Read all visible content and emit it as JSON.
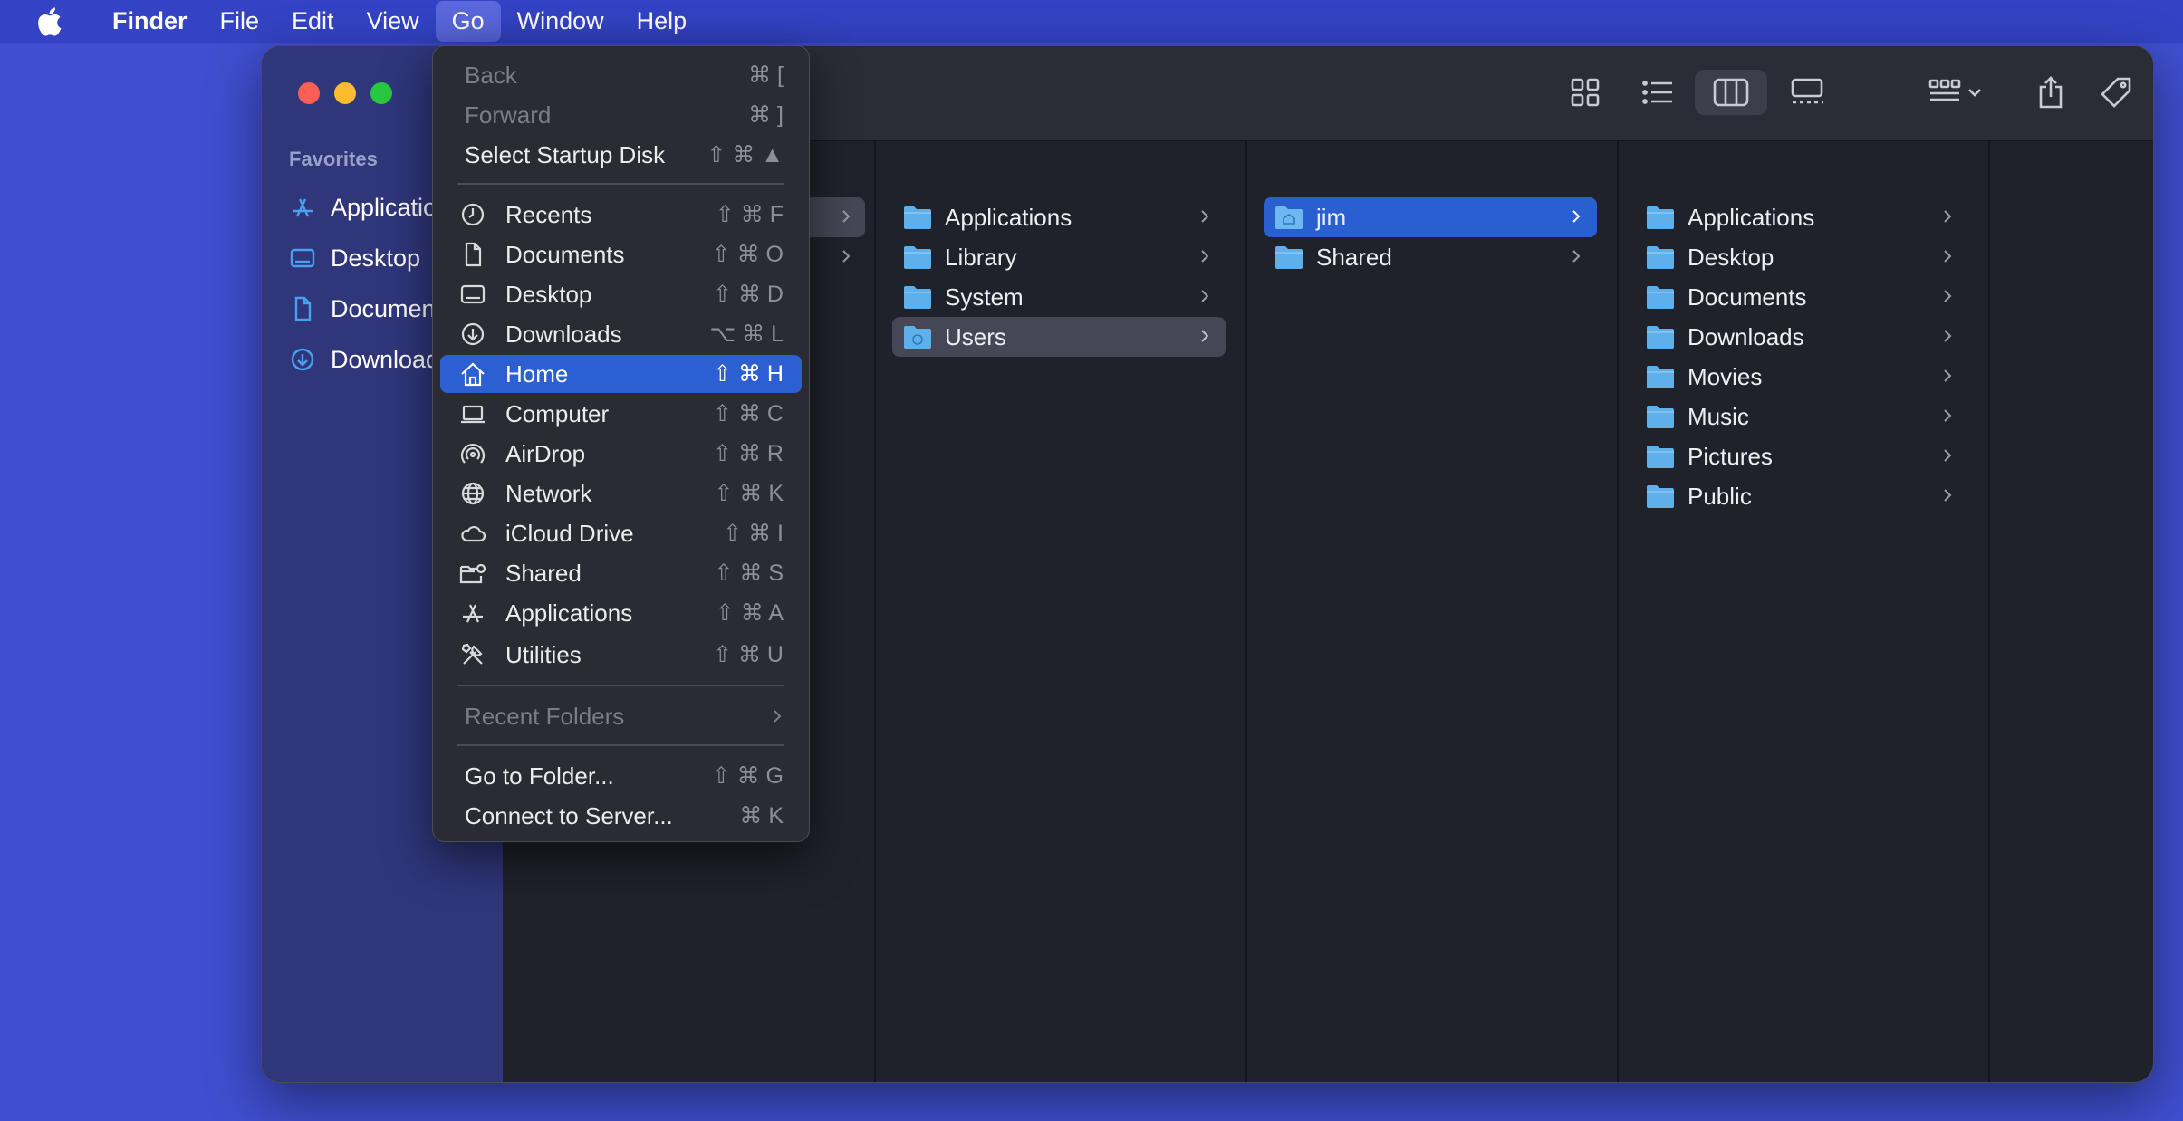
{
  "menubar": {
    "app_name": "Finder",
    "items": [
      "File",
      "Edit",
      "View",
      "Go",
      "Window",
      "Help"
    ],
    "active": "Go"
  },
  "sidebar": {
    "section": "Favorites",
    "items": [
      {
        "label": "Applications",
        "icon": "applications-icon"
      },
      {
        "label": "Desktop",
        "icon": "desktop-icon"
      },
      {
        "label": "Documents",
        "icon": "document-icon"
      },
      {
        "label": "Downloads",
        "icon": "download-icon"
      }
    ]
  },
  "columns": {
    "root": [
      "Applications",
      "Library",
      "System",
      "Users"
    ],
    "users": [
      "jim",
      "Shared"
    ],
    "jim": [
      "Applications",
      "Desktop",
      "Documents",
      "Downloads",
      "Movies",
      "Music",
      "Pictures",
      "Public"
    ],
    "selected_root": "Users",
    "selected_users": "jim"
  },
  "go_menu": {
    "back": {
      "label": "Back",
      "shortcut": "⌘ ["
    },
    "forward": {
      "label": "Forward",
      "shortcut": "⌘ ]"
    },
    "startup": {
      "label": "Select Startup Disk",
      "shortcut": "⇧ ⌘ ▲"
    },
    "items": [
      {
        "label": "Recents",
        "shortcut": "⇧ ⌘ F",
        "icon": "clock-icon"
      },
      {
        "label": "Documents",
        "shortcut": "⇧ ⌘ O",
        "icon": "document-icon"
      },
      {
        "label": "Desktop",
        "shortcut": "⇧ ⌘ D",
        "icon": "desktop-icon"
      },
      {
        "label": "Downloads",
        "shortcut": "⌥ ⌘ L",
        "icon": "download-icon"
      },
      {
        "label": "Home",
        "shortcut": "⇧ ⌘ H",
        "icon": "home-icon"
      },
      {
        "label": "Computer",
        "shortcut": "⇧ ⌘ C",
        "icon": "laptop-icon"
      },
      {
        "label": "AirDrop",
        "shortcut": "⇧ ⌘ R",
        "icon": "airdrop-icon"
      },
      {
        "label": "Network",
        "shortcut": "⇧ ⌘ K",
        "icon": "globe-icon"
      },
      {
        "label": "iCloud Drive",
        "shortcut": "⇧ ⌘ I",
        "icon": "cloud-icon"
      },
      {
        "label": "Shared",
        "shortcut": "⇧ ⌘ S",
        "icon": "shared-folder-icon"
      },
      {
        "label": "Applications",
        "shortcut": "⇧ ⌘ A",
        "icon": "applications-icon"
      },
      {
        "label": "Utilities",
        "shortcut": "⇧ ⌘ U",
        "icon": "tools-icon"
      }
    ],
    "highlighted": "Home",
    "recent_folders": {
      "label": "Recent Folders"
    },
    "go_to_folder": {
      "label": "Go to Folder...",
      "shortcut": "⇧ ⌘ G"
    },
    "connect": {
      "label": "Connect to Server...",
      "shortcut": "⌘ K"
    }
  },
  "colors": {
    "desktop": "#3f4fd0",
    "selection": "#2c5fd2",
    "folder": "#5fb0ea"
  }
}
